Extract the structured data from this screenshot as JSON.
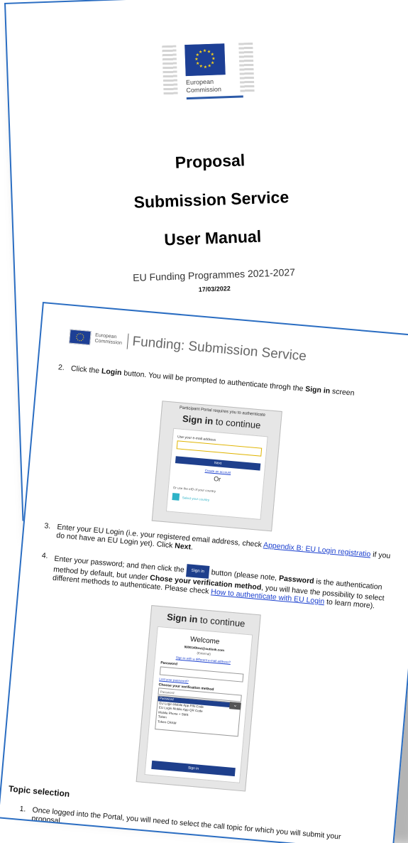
{
  "cover": {
    "org_name": "European Commission",
    "title_line1": "Proposal",
    "title_line2": "Submission Service",
    "title_line3": "User Manual",
    "subtitle": "EU Funding Programmes 2021-2027",
    "date": "17/03/2022"
  },
  "page": {
    "header": {
      "org_name": "European Commission",
      "title": "Funding: Submission Service"
    },
    "step2": {
      "number": "2.",
      "text_a": "Click the ",
      "bold_a": "Login",
      "text_b": " button. You will be prompted to authenticate throgh the ",
      "bold_b": "Sign in",
      "text_c": " screen"
    },
    "signin_shot": {
      "portal_note": "Participant Portal requires you to authenticate",
      "heading_bold": "Sign in",
      "heading_rest": " to continue",
      "email_label": "Use your e-mail address",
      "next_label": "Next",
      "create_account": "Create an account",
      "or_label": "Or",
      "eid_label": "Or use the eID of your country",
      "eid_link": "Select your country"
    },
    "step3": {
      "number": "3.",
      "text_a": "Enter your EU Login (i.e. your registered email address, check ",
      "link": "Appendix B: EU Login registratio",
      "text_b": " if you do not have an EU Login yet). Click ",
      "bold": "Next",
      "text_c": "."
    },
    "step4": {
      "number": "4.",
      "text_a": "Enter your password; and then click the ",
      "button_label": "Sign in",
      "text_b": " button (please note, ",
      "bold_a": "Password",
      "text_c": " is the authentication method by default, but under ",
      "bold_b": "Chose your verification method",
      "text_d": ", you will have the possibility to select different methods to authenticate. Please check ",
      "link": "How to authenticate with EU Login",
      "text_e": " to learn more)."
    },
    "password_shot": {
      "heading_bold": "Sign in",
      "heading_rest": " to continue",
      "welcome": "Welcome",
      "email": "9000140test@outlook.com",
      "external": "(External)",
      "diff_email": "Sign in with a different e-mail address?",
      "password_label": "Password",
      "lost_password": "Lost your password?",
      "verification_label": "Choose your verification method",
      "selected": "Password",
      "options": [
        "Password",
        "EU Login Mobile App PIN Code",
        "EU Login Mobile App QR Code",
        "Mobile Phone + SMS",
        "Token",
        "Token CRAM"
      ],
      "sign_in_label": "Sign in"
    },
    "topic_heading": "Topic selection",
    "step1": {
      "number": "1.",
      "text": "Once logged into the Portal, you will need to select the call topic for which you will submit your proposal."
    }
  }
}
